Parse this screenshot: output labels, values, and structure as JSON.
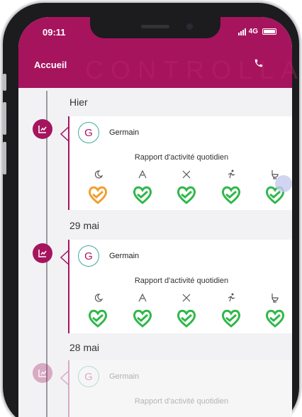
{
  "status_bar": {
    "time": "09:11",
    "network": "4G"
  },
  "header": {
    "title": "Accueil",
    "phone_icon": "phone-icon"
  },
  "watermark": "CONTROLLA",
  "colors": {
    "brand": "#a6145e",
    "heart_green": "#2fb84a",
    "heart_orange": "#f0a030",
    "avatar_ring": "#3fa8a0"
  },
  "timeline": [
    {
      "day": "Hier",
      "entry": {
        "avatar_letter": "G",
        "name": "Germain",
        "report_title": "Rapport d'activité quotidien",
        "activities": [
          {
            "icon": "sleep-icon",
            "status": "orange"
          },
          {
            "icon": "meal-icon",
            "status": "green"
          },
          {
            "icon": "hygiene-icon",
            "status": "green"
          },
          {
            "icon": "activity-icon",
            "status": "green"
          },
          {
            "icon": "toilet-icon",
            "status": "green"
          }
        ]
      }
    },
    {
      "day": "29 mai",
      "entry": {
        "avatar_letter": "G",
        "name": "Germain",
        "report_title": "Rapport d'activité quotidien",
        "activities": [
          {
            "icon": "sleep-icon",
            "status": "green"
          },
          {
            "icon": "meal-icon",
            "status": "green"
          },
          {
            "icon": "hygiene-icon",
            "status": "green"
          },
          {
            "icon": "activity-icon",
            "status": "green"
          },
          {
            "icon": "toilet-icon",
            "status": "green"
          }
        ]
      }
    },
    {
      "day": "28 mai",
      "entry": {
        "avatar_letter": "G",
        "name": "Germain",
        "report_title": "Rapport d'activité quotidien"
      }
    }
  ]
}
